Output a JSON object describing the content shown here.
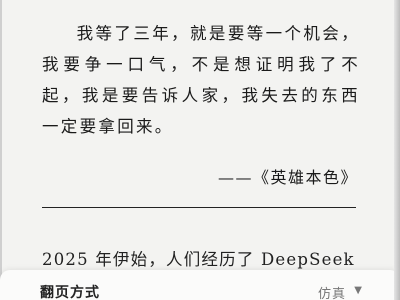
{
  "quote": {
    "text": "我等了三年，就是要等一个机会，我要争一口气，不是想证明我了不起，我是要告诉人家，我失去的东西一定要拿回来。",
    "attribution": "——《英雄本色》"
  },
  "body": {
    "text": "2025 年伊始，人们经历了 DeepSeek"
  },
  "settings_sheet": {
    "label": "翻页方式",
    "value": "仿真"
  }
}
